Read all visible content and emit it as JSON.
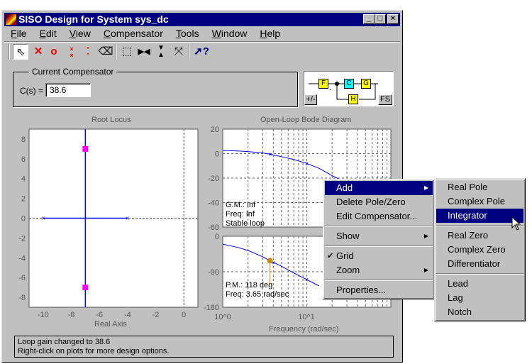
{
  "window": {
    "title": "SISO Design for System sys_dc",
    "min": "_",
    "max": "□",
    "close": "×"
  },
  "menubar": [
    "File",
    "Edit",
    "View",
    "Compensator",
    "Tools",
    "Window",
    "Help"
  ],
  "toolbar": {
    "icons": [
      "select-arrow-icon",
      "add-real-pole-icon",
      "add-real-zero-icon",
      "add-complex-pole-icon",
      "add-complex-zero-icon",
      "eraser-icon",
      "zoom-box-icon",
      "zoom-x-icon",
      "zoom-y-icon",
      "fit-icon",
      "help-icon"
    ]
  },
  "compensator": {
    "group_label": "Current Compensator",
    "label": "C(s) =",
    "value": "38.6"
  },
  "diagram": {
    "blocks": [
      "F",
      "C",
      "G",
      "H"
    ],
    "sign": "-",
    "sign_button": "+/-",
    "fs_button": "FS",
    "colors": {
      "F": "#ffff00",
      "C": "#00ffff",
      "G": "#ffff00",
      "H": "#ffff00"
    }
  },
  "root_locus": {
    "title": "Root Locus",
    "xlabel": "Real Axis"
  },
  "bode": {
    "title": "Open-Loop Bode Diagram",
    "xlabel": "Frequency (rad/sec)",
    "gm": "G.M.: Inf",
    "gm_freq": "Freq: Inf",
    "stable": "Stable loop",
    "pm": "P.M.: 118 deg",
    "pm_freq": "Freq: 3.65 rad/sec"
  },
  "status": {
    "line1": "Loop gain changed to 38.6",
    "line2": "Right-click on plots for more design options."
  },
  "context_menu": {
    "items": [
      "Add",
      "Delete Pole/Zero",
      "Edit Compensator...",
      "Show",
      "Grid",
      "Zoom",
      "Properties..."
    ],
    "grid_checked": true
  },
  "submenu": {
    "items": [
      "Real Pole",
      "Complex Pole",
      "Integrator",
      "Real Zero",
      "Complex Zero",
      "Differentiator",
      "Lead",
      "Lag",
      "Notch"
    ],
    "highlighted": "Integrator"
  },
  "chart_data": [
    {
      "type": "scatter",
      "title": "Root Locus",
      "xlabel": "Real Axis",
      "xlim": [
        -11,
        1
      ],
      "ylim": [
        -9,
        9
      ],
      "xticks": [
        -10,
        -8,
        -6,
        -4,
        -2,
        0
      ],
      "yticks": [
        -8,
        -6,
        -4,
        -2,
        0,
        2,
        4,
        6,
        8
      ],
      "open_loop_poles": [
        [
          -10,
          0
        ],
        [
          -4,
          0
        ]
      ],
      "closed_loop_poles": [
        [
          -7,
          7
        ],
        [
          -7,
          -7
        ]
      ],
      "locus": [
        [
          [
            -10,
            0
          ],
          [
            -4,
            0
          ]
        ],
        [
          [
            -7,
            -9
          ],
          [
            -7,
            9
          ]
        ]
      ]
    },
    {
      "type": "line",
      "title": "Open-Loop Bode Magnitude",
      "xscale": "log",
      "xlim": [
        1,
        100
      ],
      "ylim": [
        -60,
        20
      ],
      "yticks": [
        20,
        0,
        -20,
        -40,
        -60
      ],
      "x": [
        1,
        1.5,
        2,
        3,
        3.65,
        5,
        7,
        10,
        14,
        20,
        30
      ],
      "y": [
        2.5,
        2.2,
        1.7,
        0.6,
        -0.5,
        -2.5,
        -4.8,
        -8,
        -12,
        -18,
        -24
      ],
      "markers": [
        [
          3.65,
          -0.5
        ],
        [
          10,
          -8
        ]
      ]
    },
    {
      "type": "line",
      "title": "Open-Loop Bode Phase",
      "xscale": "log",
      "xlim": [
        1,
        100
      ],
      "ylim": [
        -180,
        0
      ],
      "yticks": [
        0,
        -90,
        -180
      ],
      "xticks": [
        "10^0",
        "10^1"
      ],
      "x": [
        1,
        1.5,
        2,
        3,
        3.65,
        5,
        7,
        10,
        14
      ],
      "y": [
        -20,
        -28,
        -36,
        -52,
        -62,
        -76,
        -93,
        -110,
        -126
      ],
      "markers": [
        [
          4,
          -67
        ],
        [
          10,
          -110
        ]
      ],
      "pm_point": [
        3.65,
        -62
      ]
    }
  ]
}
